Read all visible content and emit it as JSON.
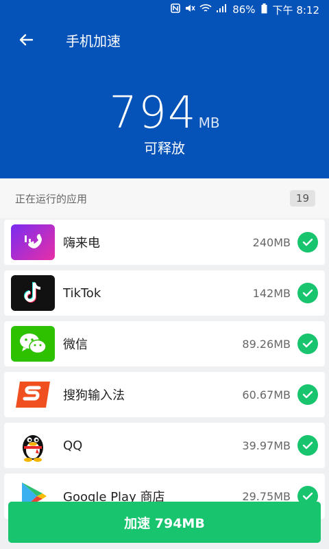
{
  "status": {
    "battery": "86%",
    "time": "下午 8:12"
  },
  "header": {
    "title": "手机加速",
    "amount": "794",
    "unit": "MB",
    "subtitle": "可释放"
  },
  "section": {
    "title": "正在运行的应用",
    "count": "19"
  },
  "apps": [
    {
      "name": "嗨来电",
      "size": "240MB",
      "icon": "hilaidian-app-icon"
    },
    {
      "name": "TikTok",
      "size": "142MB",
      "icon": "tiktok-app-icon"
    },
    {
      "name": "微信",
      "size": "89.26MB",
      "icon": "wechat-app-icon"
    },
    {
      "name": "搜狗输入法",
      "size": "60.67MB",
      "icon": "sogou-input-app-icon"
    },
    {
      "name": "QQ",
      "size": "39.97MB",
      "icon": "qq-app-icon"
    },
    {
      "name": "Google Play 商店",
      "size": "29.75MB",
      "icon": "google-play-app-icon"
    }
  ],
  "action": {
    "label": "加速 794MB"
  },
  "colors": {
    "header": "#0553b8",
    "accent": "#18c46e"
  }
}
